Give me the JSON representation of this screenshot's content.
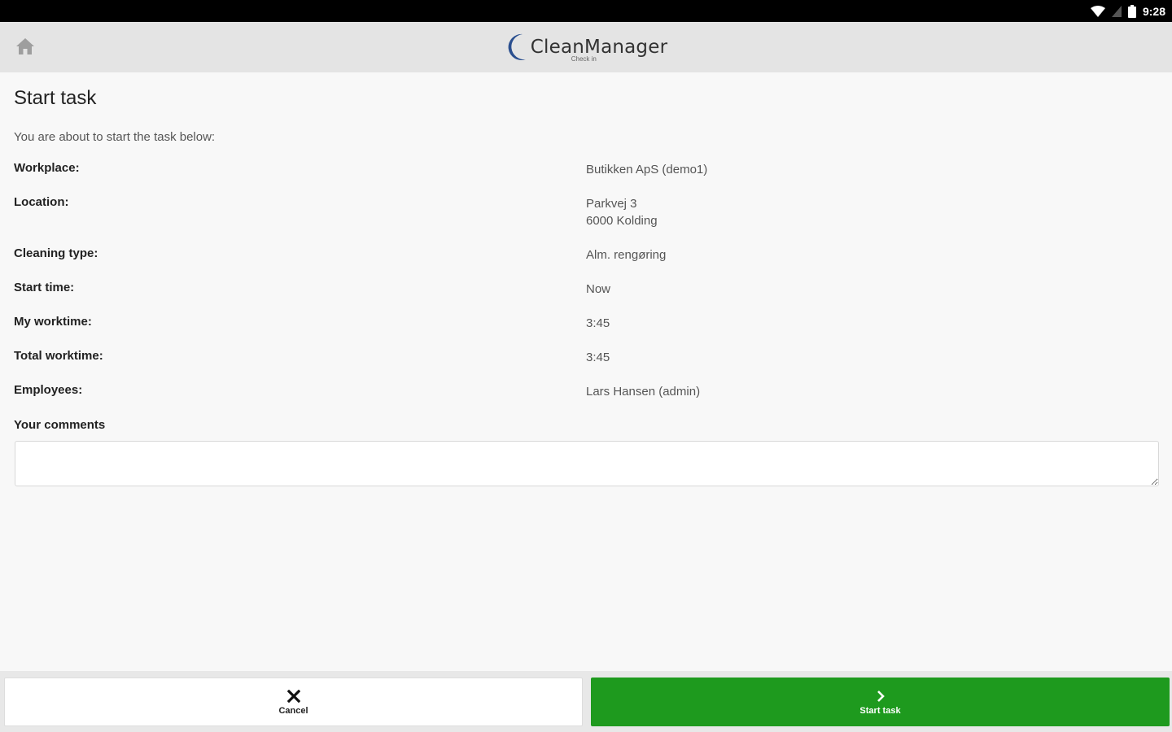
{
  "status_bar": {
    "time": "9:28",
    "icons": [
      "wifi-icon",
      "signal-icon",
      "battery-icon"
    ]
  },
  "app_bar": {
    "home_icon": "home-icon",
    "logo_text": "CleanManager",
    "logo_subtitle": "Check in"
  },
  "page": {
    "title": "Start task",
    "intro": "You are about to start the task below:"
  },
  "details": [
    {
      "label": "Workplace:",
      "value": "Butikken ApS (demo1)"
    },
    {
      "label": "Location:",
      "value_line1": "Parkvej 3",
      "value_line2": "6000 Kolding"
    },
    {
      "label": "Cleaning type:",
      "value": "Alm. rengøring"
    },
    {
      "label": "Start time:",
      "value": "Now"
    },
    {
      "label": "My worktime:",
      "value": "3:45"
    },
    {
      "label": "Total worktime:",
      "value": "3:45"
    },
    {
      "label": "Employees:",
      "value": "Lars Hansen (admin)"
    }
  ],
  "comments": {
    "label": "Your comments",
    "value": "",
    "placeholder": ""
  },
  "actions": {
    "cancel_label": "Cancel",
    "cancel_icon": "close-icon",
    "start_label": "Start task",
    "start_icon": "chevron-right-icon"
  },
  "colors": {
    "status_bar": "#000000",
    "app_bar": "#e4e4e4",
    "start_button": "#1e9a1e",
    "logo_blue": "#2a4f8f"
  }
}
